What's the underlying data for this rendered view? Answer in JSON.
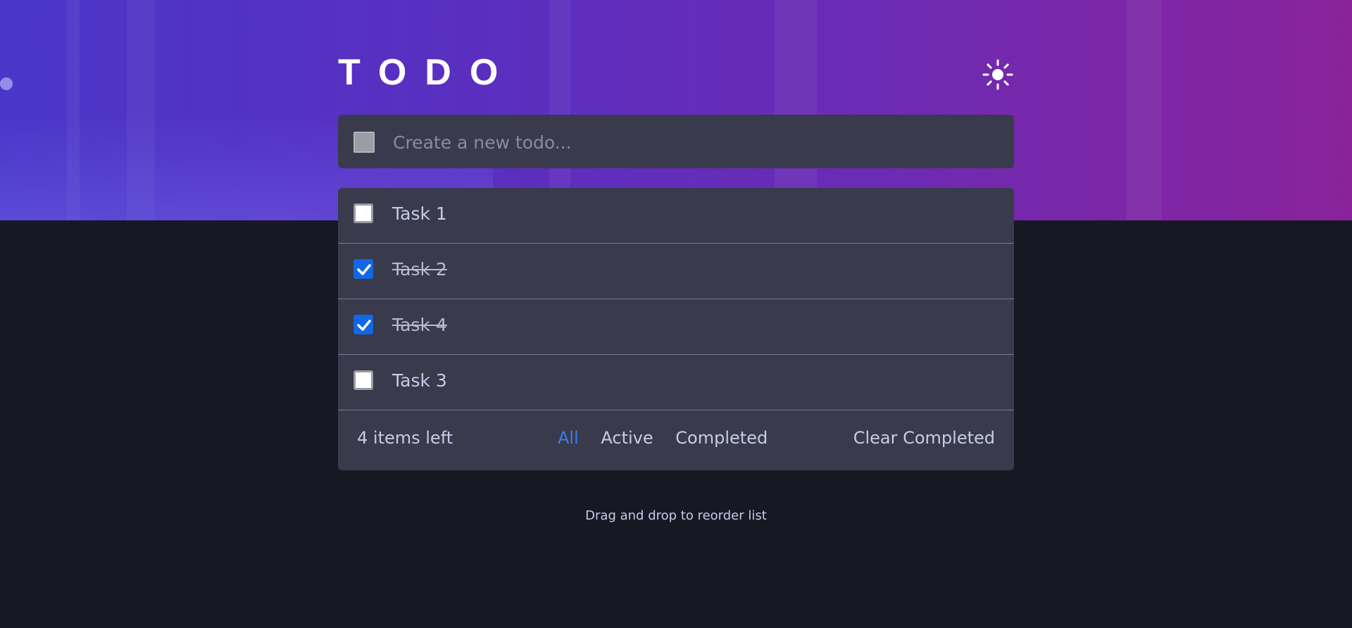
{
  "header": {
    "title": "TODO",
    "theme_icon": "sun-icon"
  },
  "new_todo": {
    "placeholder": "Create a new todo..."
  },
  "todos": [
    {
      "label": "Task 1",
      "completed": false
    },
    {
      "label": "Task 2",
      "completed": true
    },
    {
      "label": "Task 4",
      "completed": true
    },
    {
      "label": "Task 3",
      "completed": false
    }
  ],
  "footer": {
    "items_left": "4 items left",
    "filters": [
      "All",
      "Active",
      "Completed"
    ],
    "active_filter": "All",
    "clear_label": "Clear Completed"
  },
  "hint": "Drag and drop to reorder list",
  "colors": {
    "accent": "#3a7ce8",
    "checkbox_checked": "#1267e5",
    "card_bg": "#393a4c",
    "page_bg": "#181824"
  }
}
